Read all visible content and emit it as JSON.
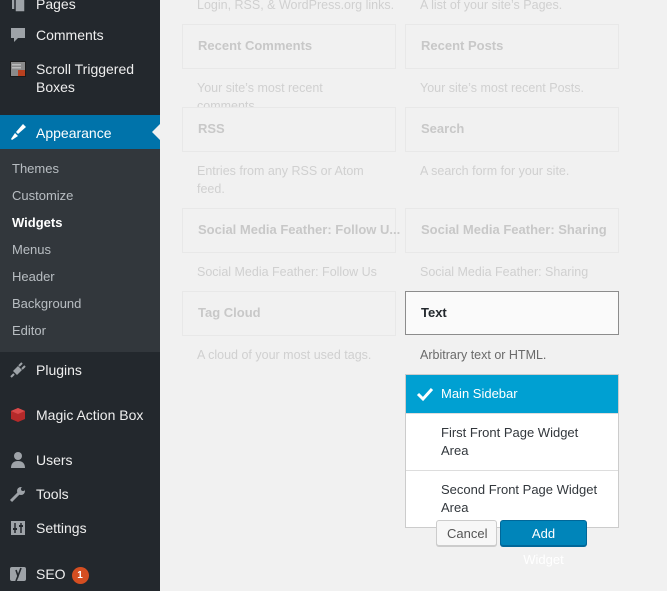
{
  "sidebar": {
    "items": [
      {
        "label": "Pages",
        "icon": "pages-icon"
      },
      {
        "label": "Comments",
        "icon": "comments-icon"
      },
      {
        "label": "Scroll Triggered Boxes",
        "icon": "scroll-triggered-boxes-icon"
      },
      {
        "label": "Appearance",
        "icon": "paintbrush-icon",
        "active": true
      },
      {
        "label": "Plugins",
        "icon": "plug-icon"
      },
      {
        "label": "Magic Action Box",
        "icon": "magic-box-icon"
      },
      {
        "label": "Users",
        "icon": "user-icon"
      },
      {
        "label": "Tools",
        "icon": "wrench-icon"
      },
      {
        "label": "Settings",
        "icon": "settings-sliders-icon"
      },
      {
        "label": "SEO",
        "icon": "yoast-icon",
        "badge": "1"
      }
    ],
    "submenu": [
      {
        "label": "Themes"
      },
      {
        "label": "Customize"
      },
      {
        "label": "Widgets",
        "current": true
      },
      {
        "label": "Menus"
      },
      {
        "label": "Header"
      },
      {
        "label": "Background"
      },
      {
        "label": "Editor"
      }
    ]
  },
  "colors": {
    "sidebar_bg": "#23282d",
    "submenu_bg": "#32373c",
    "active_bg": "#0073aa",
    "chooser_selected": "#00a0d2",
    "primary_button": "#0085ba",
    "badge": "#d54e21"
  },
  "widgets": {
    "top_descriptions": [
      "Login, RSS, & WordPress.org links.",
      "A list of your site’s Pages."
    ],
    "items": [
      {
        "title": "Recent Comments",
        "desc": "Your site’s most recent comments."
      },
      {
        "title": "Recent Posts",
        "desc": "Your site’s most recent Posts."
      },
      {
        "title": "RSS",
        "desc": "Entries from any RSS or Atom feed."
      },
      {
        "title": "Search",
        "desc": "A search form for your site."
      },
      {
        "title": "Social Media Feather: Follow U...",
        "desc": "Social Media Feather: Follow Us"
      },
      {
        "title": "Social Media Feather: Sharing",
        "desc": "Social Media Feather: Sharing"
      },
      {
        "title": "Tag Cloud",
        "desc": "A cloud of your most used tags."
      },
      {
        "title": "Text",
        "desc": "Arbitrary text or HTML.",
        "selected": true
      }
    ]
  },
  "chooser": {
    "options": [
      {
        "label": "Main Sidebar",
        "selected": true
      },
      {
        "label": "First Front Page Widget Area"
      },
      {
        "label": "Second Front Page Widget Area"
      }
    ],
    "cancel_label": "Cancel",
    "add_label": "Add Widget"
  }
}
